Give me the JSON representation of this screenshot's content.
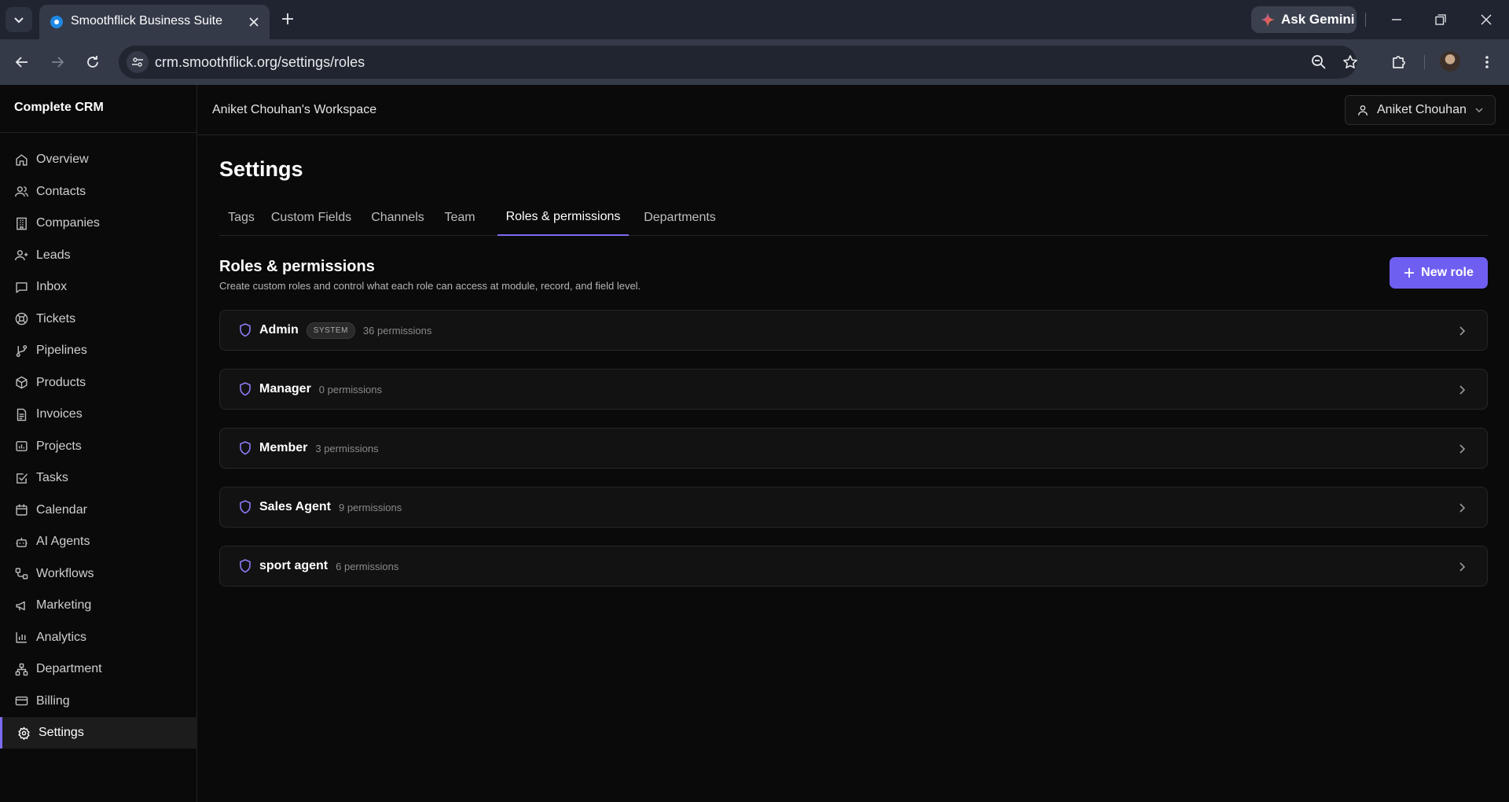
{
  "browser": {
    "tab_title": "Smoothflick Business Suite",
    "url": "crm.smoothflick.org/settings/roles",
    "gemini_label": "Ask Gemini"
  },
  "app": {
    "brand": "Complete CRM",
    "workspace": "Aniket Chouhan's Workspace",
    "user_name": "Aniket Chouhan"
  },
  "sidebar": {
    "items": [
      {
        "label": "Overview",
        "icon": "home-icon"
      },
      {
        "label": "Contacts",
        "icon": "users-icon"
      },
      {
        "label": "Companies",
        "icon": "building-icon"
      },
      {
        "label": "Leads",
        "icon": "user-plus-icon"
      },
      {
        "label": "Inbox",
        "icon": "message-icon"
      },
      {
        "label": "Tickets",
        "icon": "lifebuoy-icon"
      },
      {
        "label": "Pipelines",
        "icon": "git-branch-icon"
      },
      {
        "label": "Products",
        "icon": "package-icon"
      },
      {
        "label": "Invoices",
        "icon": "file-text-icon"
      },
      {
        "label": "Projects",
        "icon": "folder-chart-icon"
      },
      {
        "label": "Tasks",
        "icon": "check-square-icon"
      },
      {
        "label": "Calendar",
        "icon": "calendar-icon"
      },
      {
        "label": "AI Agents",
        "icon": "bot-icon"
      },
      {
        "label": "Workflows",
        "icon": "workflow-icon"
      },
      {
        "label": "Marketing",
        "icon": "megaphone-icon"
      },
      {
        "label": "Analytics",
        "icon": "bar-chart-icon"
      },
      {
        "label": "Department",
        "icon": "network-icon"
      },
      {
        "label": "Billing",
        "icon": "credit-card-icon"
      },
      {
        "label": "Settings",
        "icon": "gear-icon",
        "active": true
      }
    ]
  },
  "settings": {
    "title": "Settings",
    "tabs": [
      {
        "label": "Tags"
      },
      {
        "label": "Custom Fields"
      },
      {
        "label": "Channels"
      },
      {
        "label": "Team"
      },
      {
        "label": "Roles & permissions",
        "active": true
      },
      {
        "label": "Departments"
      }
    ],
    "section_title": "Roles & permissions",
    "section_desc": "Create custom roles and control what each role can access at module, record, and field level.",
    "new_role_label": "New role",
    "roles": [
      {
        "name": "Admin",
        "badge": "SYSTEM",
        "permissions": "36 permissions"
      },
      {
        "name": "Manager",
        "permissions": "0 permissions"
      },
      {
        "name": "Member",
        "permissions": "3 permissions"
      },
      {
        "name": "Sales Agent",
        "permissions": "9 permissions"
      },
      {
        "name": "sport agent",
        "permissions": "6 permissions"
      }
    ]
  },
  "colors": {
    "accent": "#6f5ff0",
    "background": "#0a0a0a",
    "browser_chrome": "#343a48"
  }
}
